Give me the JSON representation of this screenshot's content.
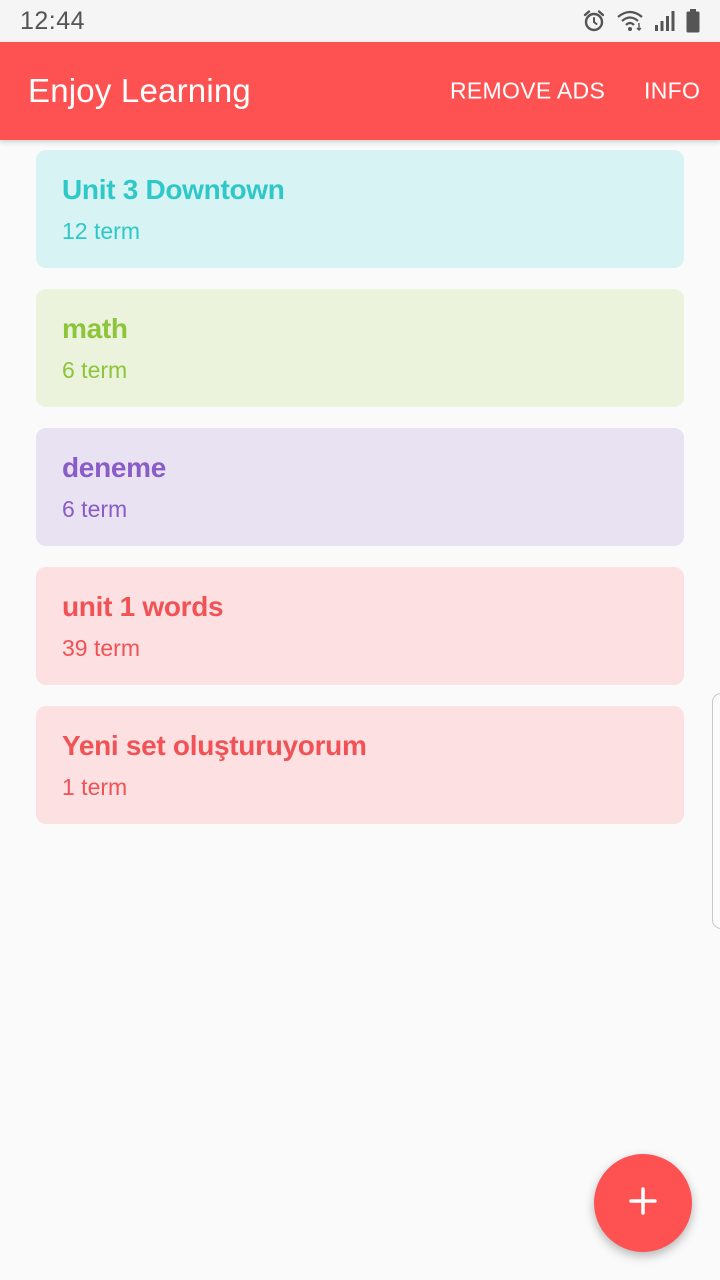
{
  "status_bar": {
    "time": "12:44",
    "icons": [
      "alarm-icon",
      "wifi-icon",
      "signal-icon",
      "battery-icon"
    ]
  },
  "app_bar": {
    "title": "Enjoy Learning",
    "actions": {
      "remove_ads": "REMOVE ADS",
      "info": "INFO"
    },
    "color": "#fe5252"
  },
  "sets": [
    {
      "title": "Unit 3 Downtown",
      "count": "12 term",
      "text_color": "#2ec8c8",
      "bg_color": "#d8f3f3"
    },
    {
      "title": "math",
      "count": "6 term",
      "text_color": "#8cc43a",
      "bg_color": "#ebf3dc"
    },
    {
      "title": "deneme",
      "count": "6 term",
      "text_color": "#8a5cc6",
      "bg_color": "#e9e2f3"
    },
    {
      "title": "unit 1 words",
      "count": "39 term",
      "text_color": "#f05255",
      "bg_color": "#fde0e1"
    },
    {
      "title": "Yeni set oluşturuyorum",
      "count": "1 term",
      "text_color": "#f05255",
      "bg_color": "#fde0e1"
    }
  ],
  "fab": {
    "icon": "plus-icon",
    "color": "#fe5252"
  }
}
